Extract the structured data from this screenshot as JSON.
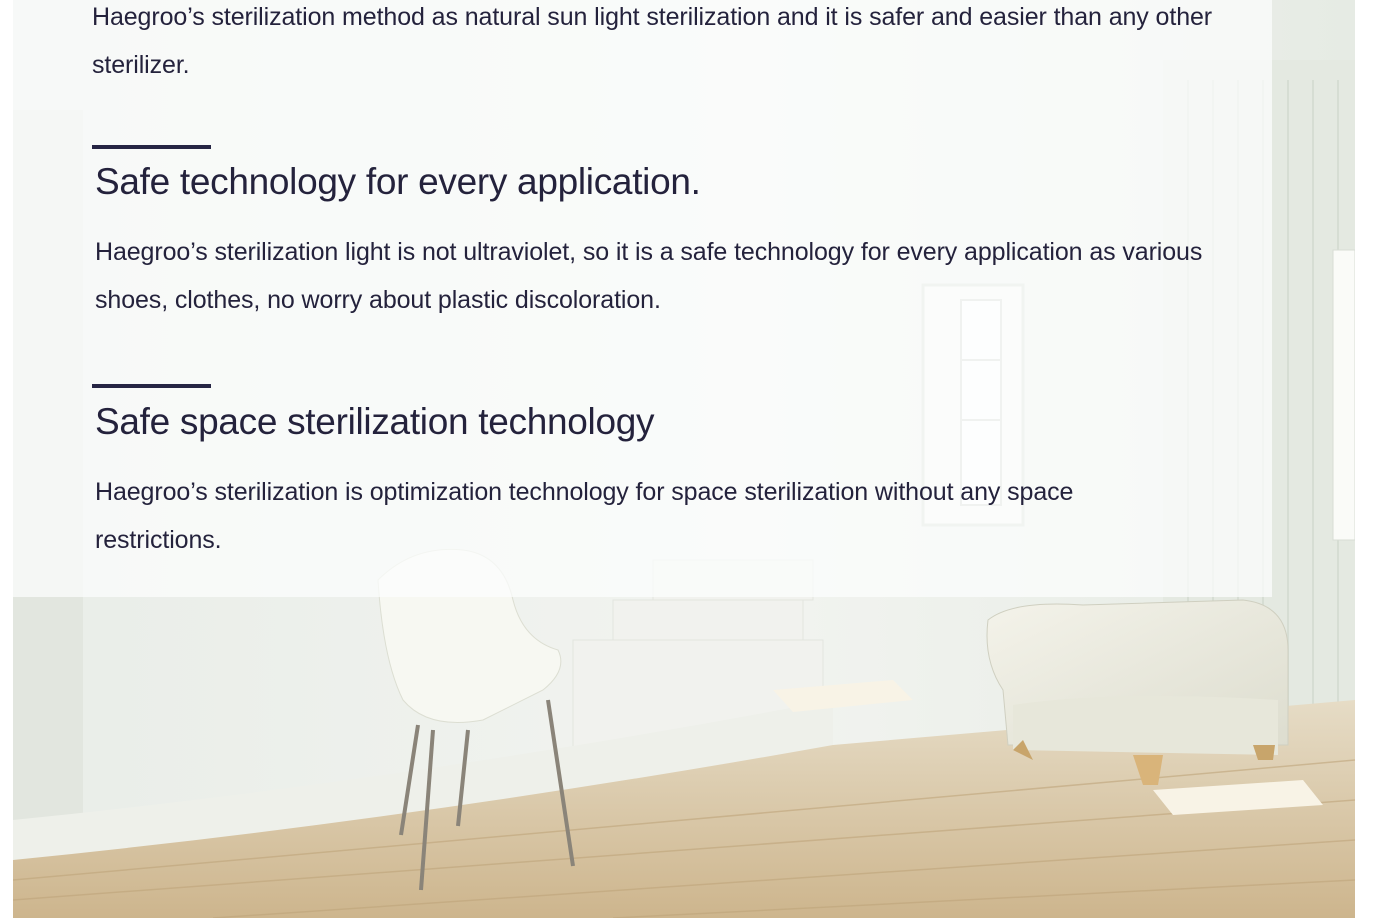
{
  "intro": {
    "text": "Haegroo’s sterilization method as natural sun light sterilization and it is safer and easier than any other sterilizer."
  },
  "sections": [
    {
      "title": "Safe technology for every application.",
      "body": "Haegroo’s sterilization light is not ultraviolet, so it is a safe technology for every application as various shoes, clothes, no worry about plastic discoloration."
    },
    {
      "title": "Safe space sterilization technology",
      "body": "Haegroo’s sterilization is optimization technology for space sterilization without any space restrictions."
    }
  ],
  "colors": {
    "text": "#24223c",
    "rule": "#262544",
    "panel": "#fcfdfd",
    "floor": "#d7c29f",
    "wall": "#eef1ec"
  },
  "icons": [
    "background-room-photo"
  ]
}
